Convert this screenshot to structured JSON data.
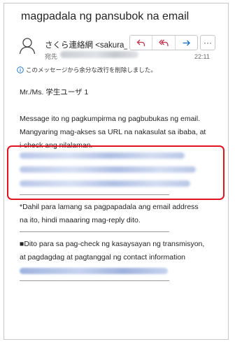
{
  "email": {
    "subject": "magpadala ng pansubok na email",
    "sender_name": "さくら連絡網 <sakura_in",
    "to_label": "宛先",
    "time": "22:11",
    "info_banner": "このメッセージから余分な改行を削除しました。",
    "more_label": "···",
    "icons": {
      "avatar": "person-icon",
      "reply": "reply-icon",
      "reply_all": "reply-all-icon",
      "forward": "forward-icon",
      "info": "info-icon"
    },
    "colors": {
      "highlight": "#e1141f",
      "reply_icons": "#c4314b",
      "forward_icon": "#0f6cbd",
      "link": "#2f5fc4"
    }
  },
  "body": {
    "greeting": "Mr./Ms. 学生ユーザ 1",
    "para1_line1": "Message ito ng pagkumpirma ng pagbubukas ng email.",
    "para1_line2": "Mangyaring mag-akses sa URL na nakasulat sa ibaba, at",
    "para1_line3": "i-check ang nilalaman.",
    "note_line1": "*Dahil para lamang sa pagpapadala ang email address",
    "note_line2": "na ito, hindi maaaring mag-reply dito.",
    "history_line1": "■Dito para sa pag-check ng kasaysayan ng transmisyon,",
    "history_line2": "at pagdagdag at pagtanggal ng contact information"
  }
}
